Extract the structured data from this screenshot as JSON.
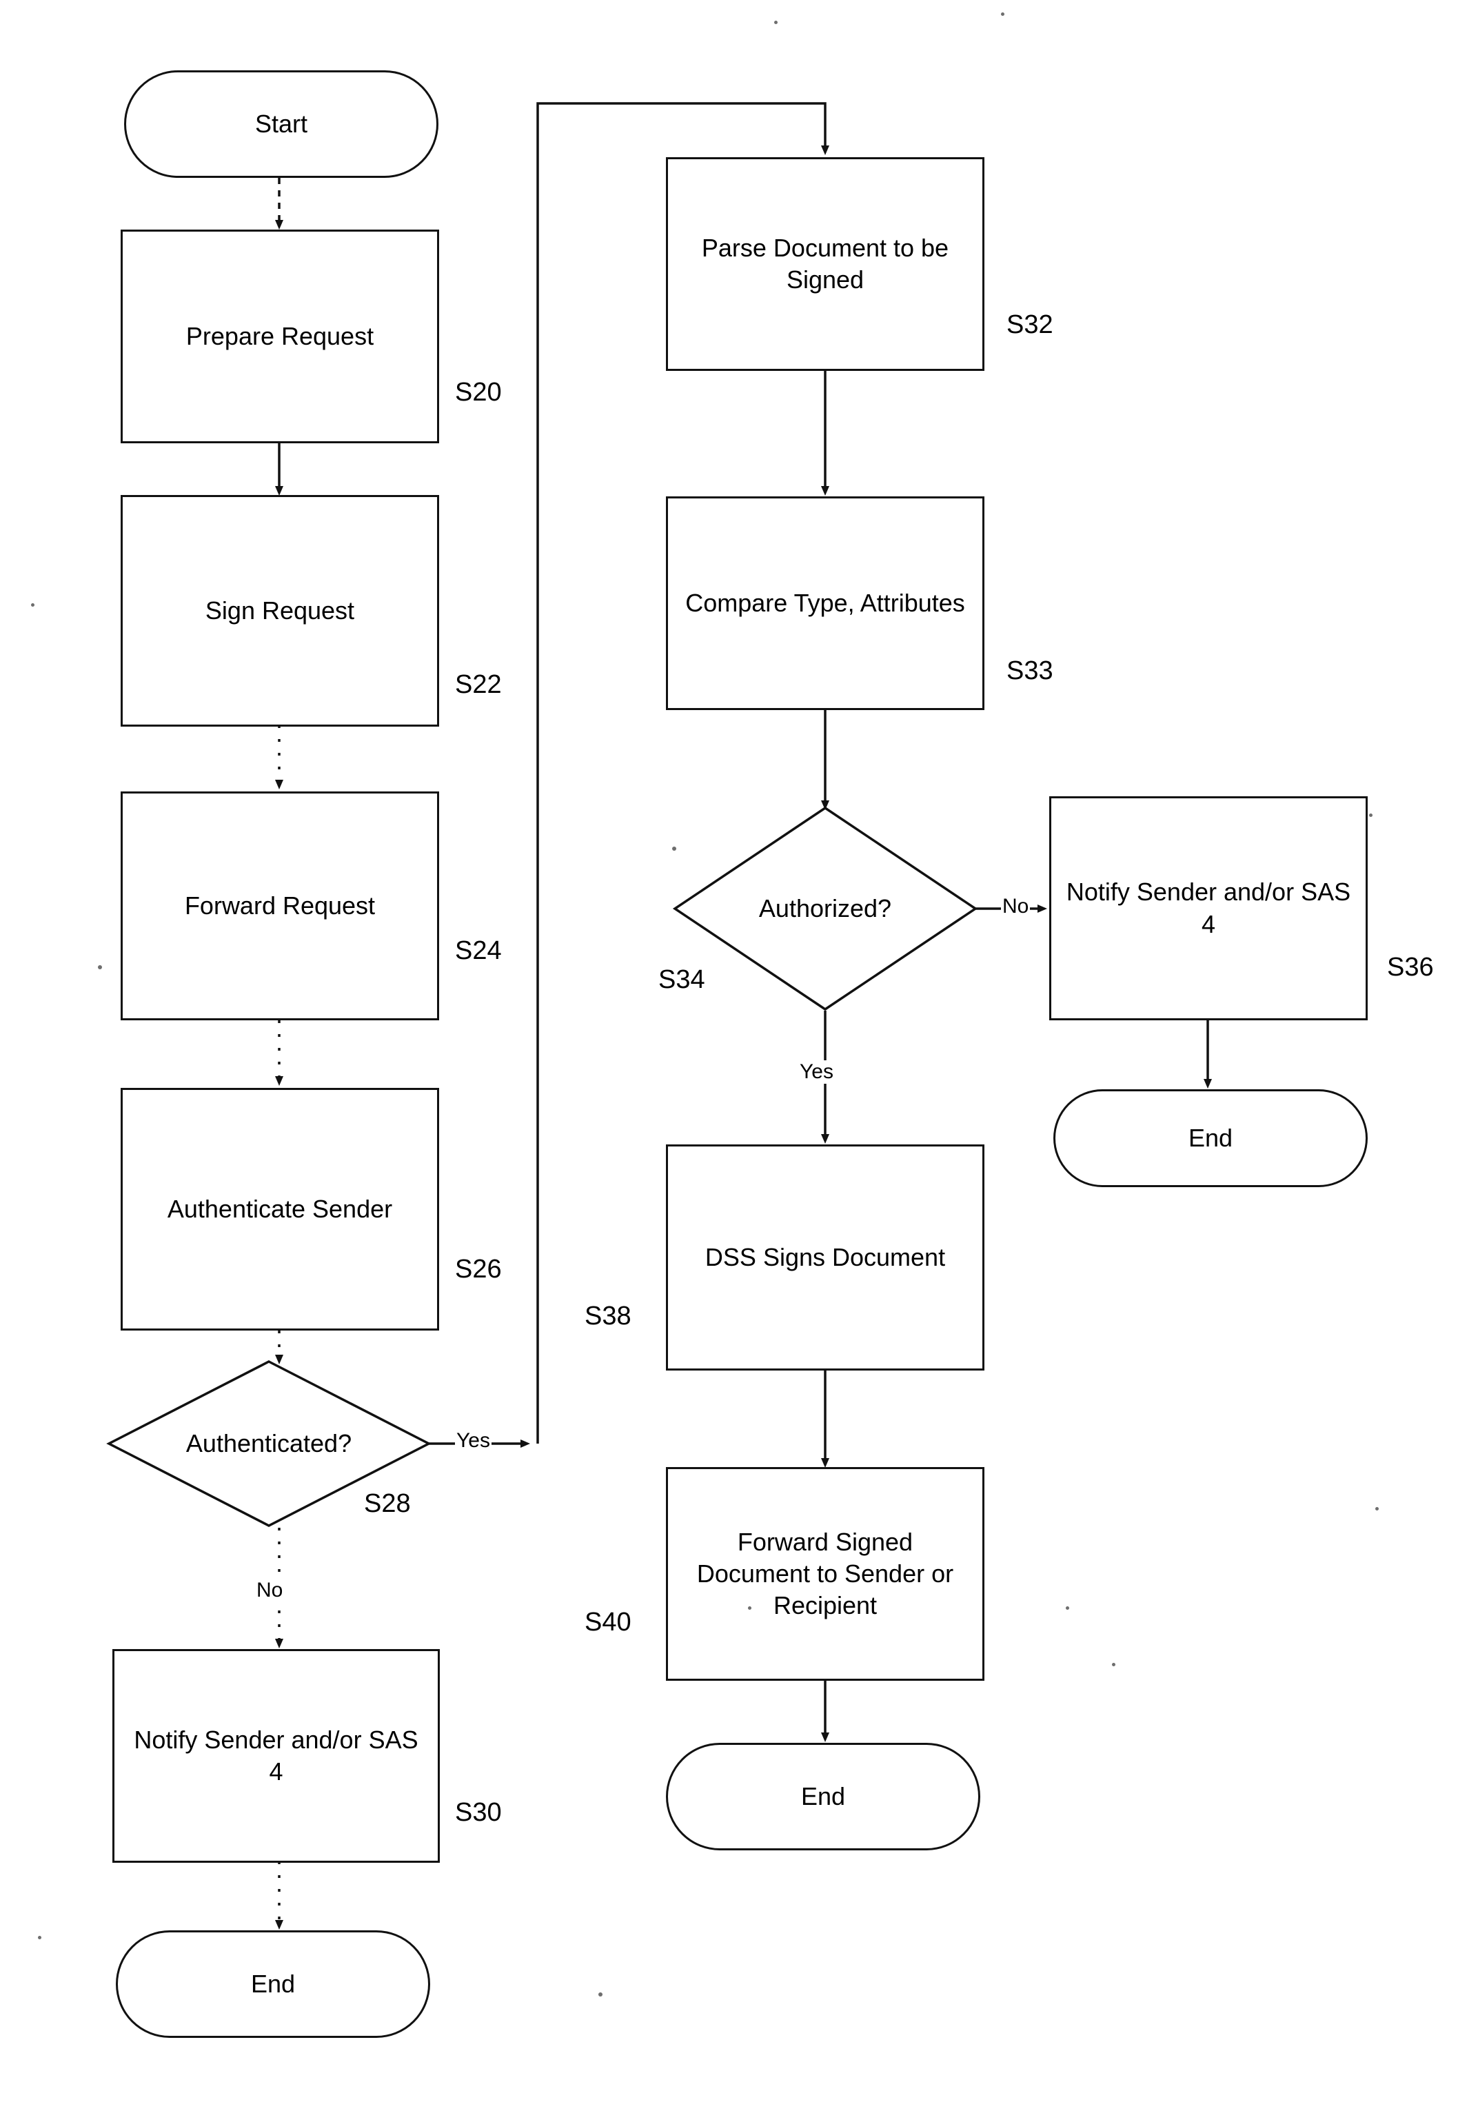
{
  "diagram": {
    "type": "flowchart",
    "title": "",
    "orientation": "top-to-bottom, three columns"
  },
  "nodes": {
    "start": {
      "label": "Start",
      "shape": "terminator",
      "step": ""
    },
    "prepare_request": {
      "label": "Prepare Request",
      "shape": "process",
      "step": "S20"
    },
    "sign_request": {
      "label": "Sign Request",
      "shape": "process",
      "step": "S22"
    },
    "forward_request": {
      "label": "Forward Request",
      "shape": "process",
      "step": "S24"
    },
    "authenticate_sender": {
      "label": "Authenticate Sender",
      "shape": "process",
      "step": "S26"
    },
    "authenticated_decision": {
      "label": "Authenticated?",
      "shape": "decision",
      "step": "S28"
    },
    "notify_sender_left": {
      "label": "Notify Sender and/or SAS 4",
      "shape": "process",
      "step": "S30"
    },
    "end_left": {
      "label": "End",
      "shape": "terminator",
      "step": ""
    },
    "parse_document": {
      "label": "Parse Document to be Signed",
      "shape": "process",
      "step": "S32"
    },
    "compare_type": {
      "label": "Compare Type, Attributes",
      "shape": "process",
      "step": "S33"
    },
    "authorized_decision": {
      "label": "Authorized?",
      "shape": "decision",
      "step": "S34"
    },
    "notify_sender_right": {
      "label": "Notify Sender and/or SAS 4",
      "shape": "process",
      "step": "S36"
    },
    "end_right": {
      "label": "End",
      "shape": "terminator",
      "step": ""
    },
    "dss_signs": {
      "label": "DSS Signs Document",
      "shape": "process",
      "step": "S38"
    },
    "forward_signed": {
      "label": "Forward Signed Document to Sender or Recipient",
      "shape": "process",
      "step": "S40"
    },
    "end_middle": {
      "label": "End",
      "shape": "terminator",
      "step": ""
    }
  },
  "edge_labels": {
    "authenticated_yes": "Yes",
    "authenticated_no": "No",
    "authorized_no": "No",
    "authorized_yes": "Yes"
  },
  "colors": {
    "stroke": "#111111",
    "text": "#000000",
    "background": "#ffffff"
  }
}
